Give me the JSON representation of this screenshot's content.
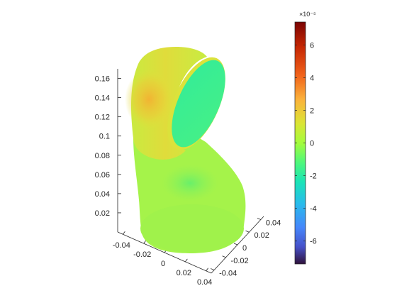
{
  "chart_data": {
    "type": "surface",
    "title": "",
    "xlabel": "",
    "ylabel": "",
    "zlabel": "",
    "axes": {
      "x": {
        "ticks": [
          "-0.04",
          "-0.02",
          "0",
          "0.02",
          "0.04"
        ],
        "range": [
          -0.045,
          0.045
        ]
      },
      "y": {
        "ticks": [
          "-0.04",
          "-0.02",
          "0",
          "0.02",
          "0.04"
        ],
        "range": [
          -0.045,
          0.045
        ]
      },
      "z": {
        "ticks": [
          "0.02",
          "0.04",
          "0.06",
          "0.08",
          "0.1",
          "0.12",
          "0.14",
          "0.16"
        ],
        "range": [
          0,
          0.17
        ]
      }
    },
    "grid": false,
    "colormap": "turbo",
    "colorbar": {
      "location": "right",
      "exponent_label": "×10⁻⁵",
      "ticks": [
        "6",
        "4",
        "2",
        "0",
        "-2",
        "-4",
        "-6"
      ],
      "tick_values": [
        6,
        4,
        2,
        0,
        -2,
        -4,
        -6
      ],
      "range": [
        -7.4,
        7.4
      ]
    },
    "surface": {
      "shape": "elbow pipe (vertical cylinder bending into an angled cross-section opening)",
      "value_range_shown": [
        -1.5,
        3.5
      ],
      "dominant_value": 0.5,
      "max_region": "upper-left outer bend",
      "min_region": "cut face interior"
    },
    "colors": {
      "hot": "#f3b132",
      "warm": "#e3e03a",
      "base": "#a6f24a",
      "cool": "#3cef82",
      "cut_face": "#30ea9c"
    }
  }
}
